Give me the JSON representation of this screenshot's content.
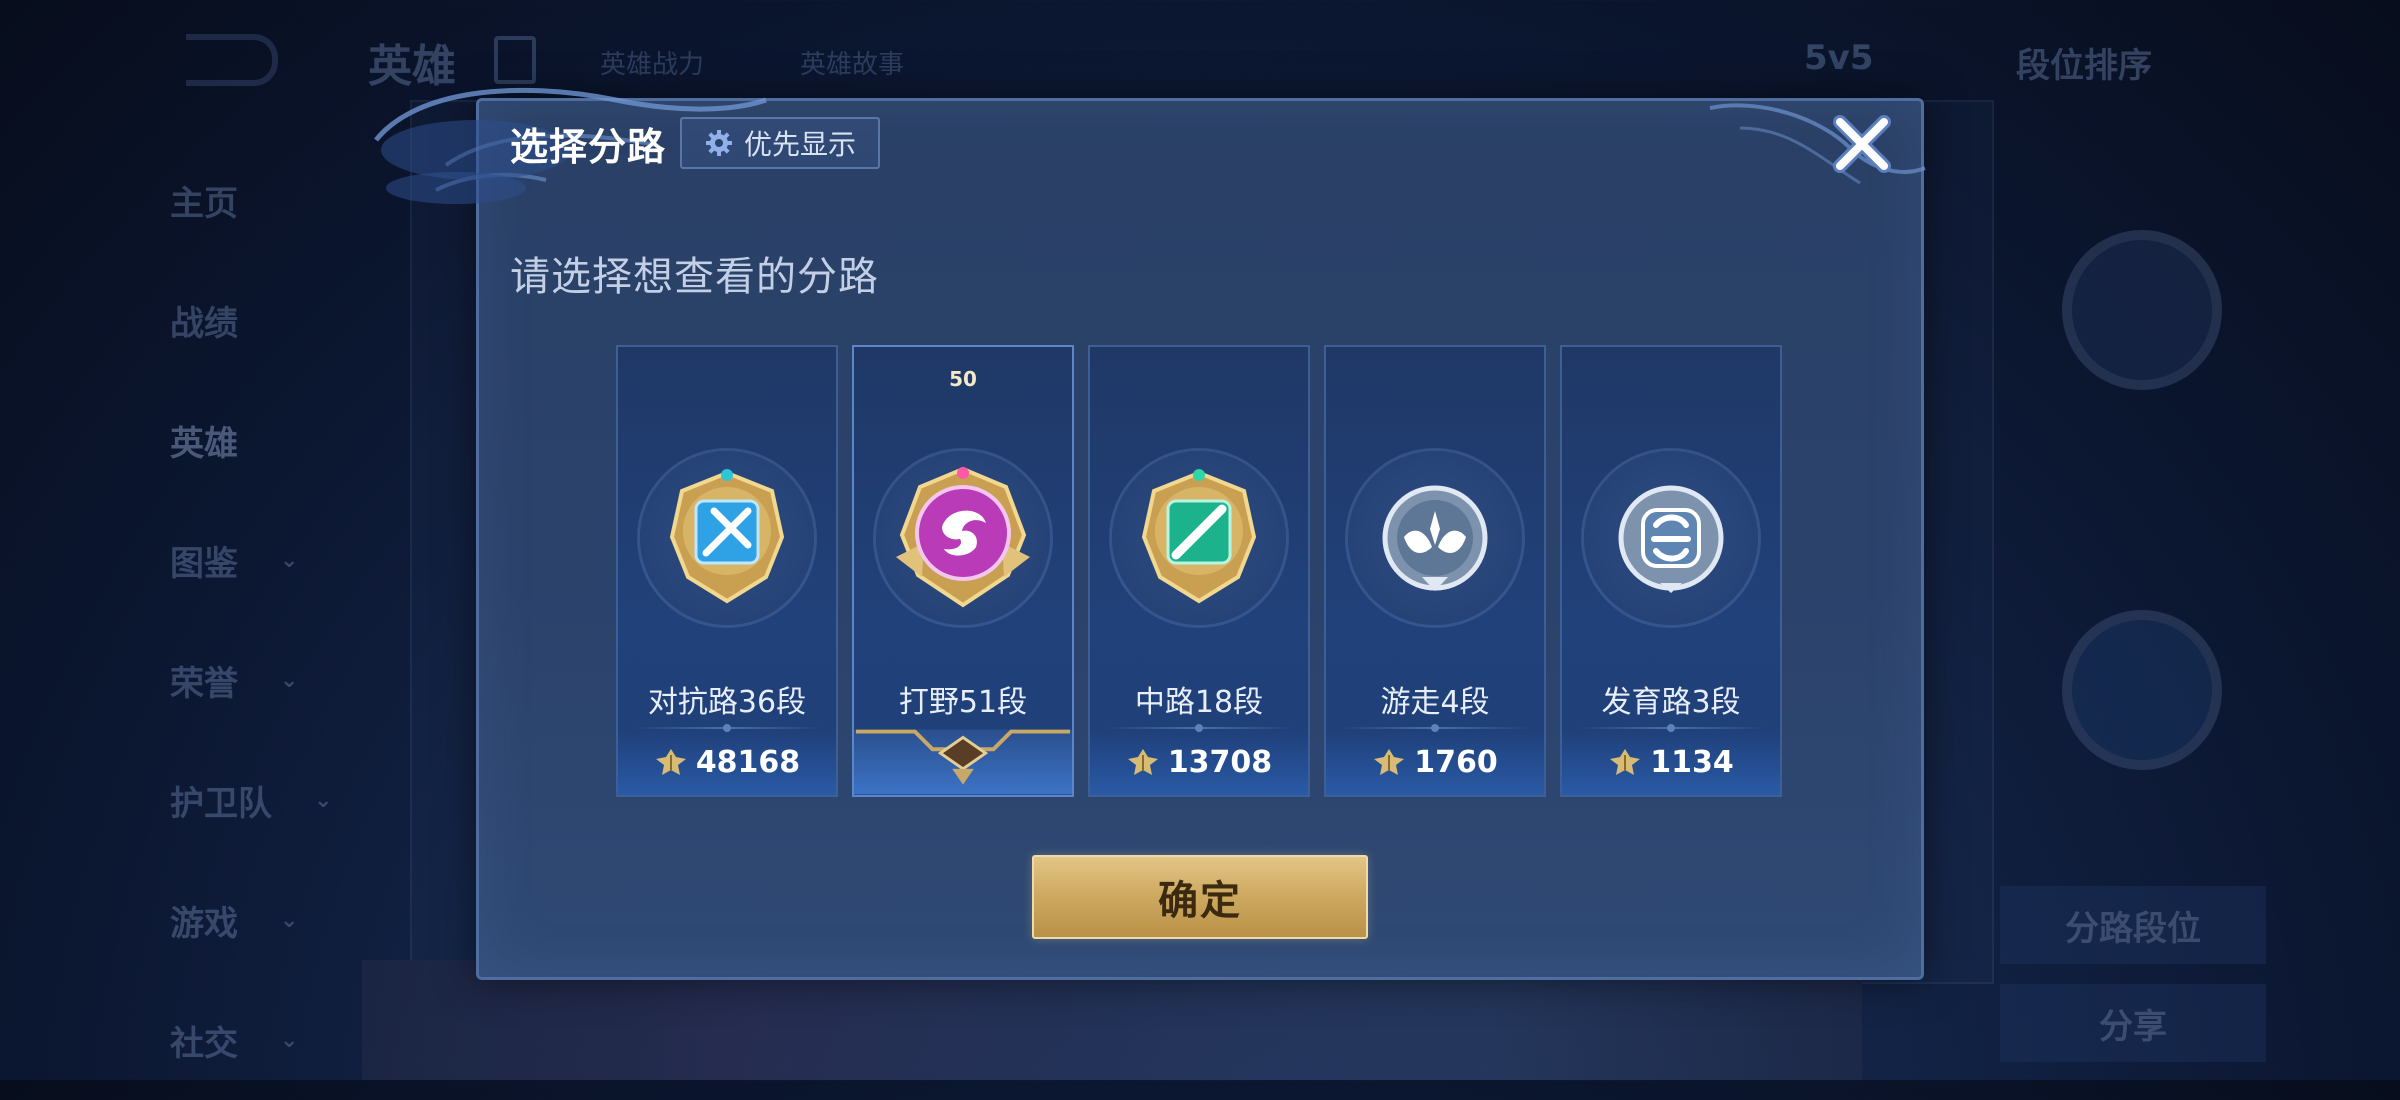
{
  "background": {
    "title": "英雄",
    "top_links": [
      "英雄战力",
      "英雄故事"
    ],
    "mode": "5v5",
    "sort": "段位排序",
    "sidebar": [
      {
        "label": "主页",
        "caret": false
      },
      {
        "label": "战绩",
        "caret": false
      },
      {
        "label": "英雄",
        "caret": false,
        "active": true
      },
      {
        "label": "图鉴",
        "caret": true
      },
      {
        "label": "荣誉",
        "caret": true
      },
      {
        "label": "护卫队",
        "caret": true
      },
      {
        "label": "游戏",
        "caret": true
      },
      {
        "label": "社交",
        "caret": true
      }
    ],
    "right_buttons": [
      "分路段位",
      "分享"
    ]
  },
  "dialog": {
    "title": "选择分路",
    "priority_label": "优先显示",
    "subtitle": "请选择想查看的分路",
    "confirm_label": "确定"
  },
  "roles": [
    {
      "name": "对抗路36段",
      "points": "48168",
      "badge_color": "#37a6e8",
      "icon": "sword-icon"
    },
    {
      "name": "打野51段",
      "points": "",
      "level": "50",
      "badge_color": "#c23fc0",
      "icon": "dragon-icon",
      "selected": true
    },
    {
      "name": "中路18段",
      "points": "13708",
      "badge_color": "#1fb58f",
      "icon": "staff-icon"
    },
    {
      "name": "游走4段",
      "points": "1760",
      "badge_color": "#9fb4cc",
      "icon": "wings-icon"
    },
    {
      "name": "发育路3段",
      "points": "1134",
      "badge_color": "#9fb4cc",
      "icon": "archer-icon"
    }
  ],
  "colors": {
    "gold": "#d4b068",
    "frame_blue": "#4f6e9f"
  }
}
